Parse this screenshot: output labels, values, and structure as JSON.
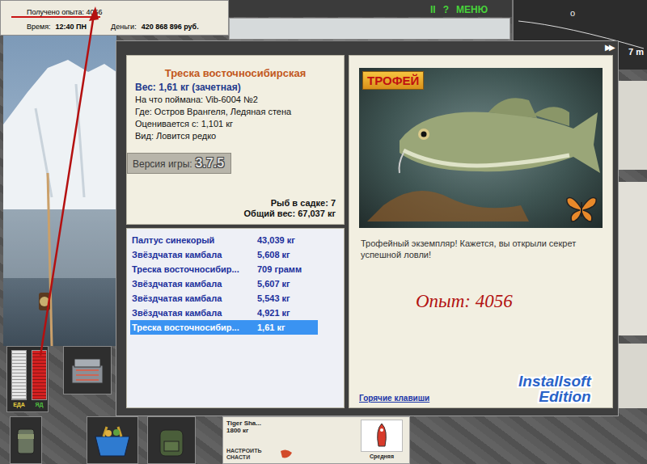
{
  "hud": {
    "experience": "Получено опыта: 4056",
    "time_label": "Время:",
    "time": "12:40 ПН",
    "money_label": "Деньги:",
    "money": "420 868 896 руб."
  },
  "top_menu": [
    "II",
    "?",
    "МЕНЮ"
  ],
  "depth": {
    "marker": "o",
    "reading": "7 m"
  },
  "dialog": {
    "skip": "▶▶",
    "title": "Треска восточносибирская",
    "weight": "Вес: 1,61 кг (зачетная)",
    "details": [
      "На что поймана: Vib-6004 №2",
      "Где: Остров Врангеля, Ледяная стена",
      "Оценивается с: 1,101 кг",
      "Вид: Ловится редко"
    ],
    "version_label": "Версия игры:",
    "version": "3.7.5",
    "keepnet_count": "Рыб в садке: 7",
    "total_weight": "Общий вес: 67,037 кг",
    "catches": [
      {
        "name": "Палтус синекорый",
        "weight": "43,039 кг",
        "selected": false
      },
      {
        "name": "Звёздчатая камбала",
        "weight": "5,608 кг",
        "selected": false
      },
      {
        "name": "Треска восточносибир...",
        "weight": "709 грамм",
        "selected": false
      },
      {
        "name": "Звёздчатая камбала",
        "weight": "5,607 кг",
        "selected": false
      },
      {
        "name": "Звёздчатая камбала",
        "weight": "5,543 кг",
        "selected": false
      },
      {
        "name": "Звёздчатая камбала",
        "weight": "4,921 кг",
        "selected": false
      },
      {
        "name": "Треска восточносибир...",
        "weight": "1,61 кг",
        "selected": true
      }
    ],
    "badge": "ТРОФЕЙ",
    "message": "Трофейный экземпляр! Кажется, вы открыли секрет успешной ловли!",
    "experience": "Опыт: 4056",
    "hotkeys": "Горячие клавиши"
  },
  "logo": [
    "Installsoft",
    "Edition"
  ],
  "meters": [
    {
      "label": "ЕДА",
      "level": 1.0,
      "color": "#e6e6e6"
    },
    {
      "label": "ЯД",
      "level": 1.0,
      "color": "#d42020"
    }
  ],
  "bottom": {
    "lure_name": "Tiger Sha...",
    "lure_weight": "1800 кг",
    "tackle_button": "НАСТРОИТЬ СНАСТИ",
    "speed": "Средняя"
  }
}
